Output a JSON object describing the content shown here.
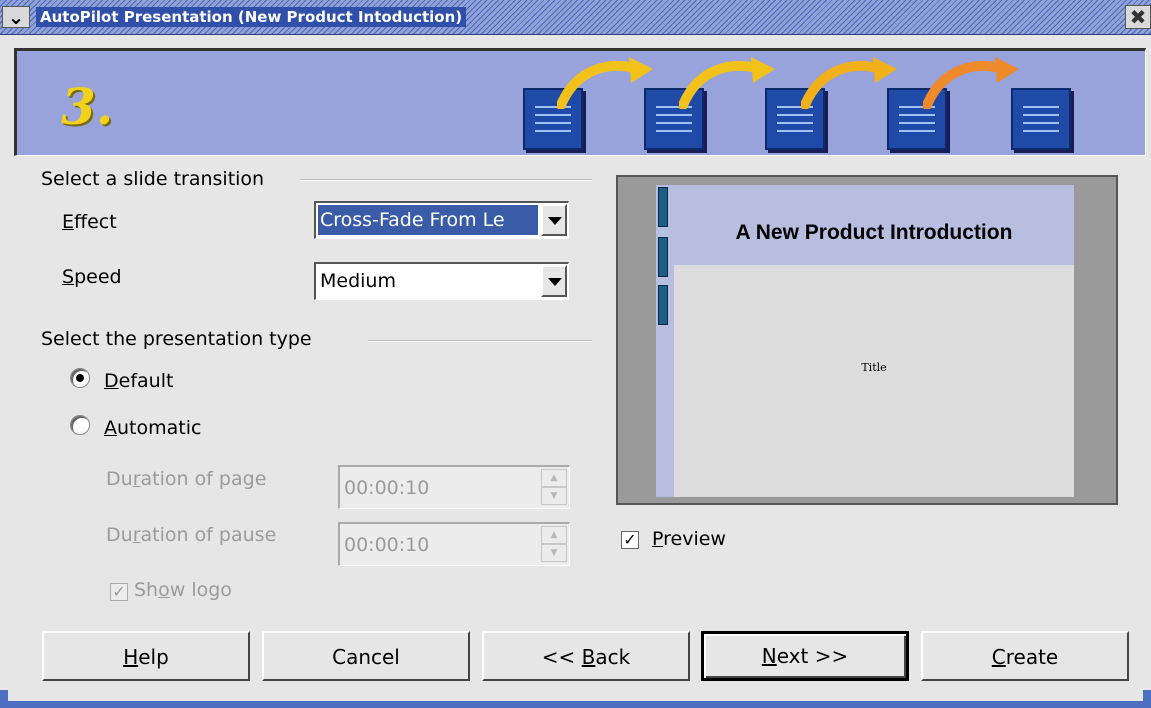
{
  "window": {
    "title": "AutoPilot Presentation (New Product Intoduction)",
    "close_glyph": "✖",
    "menu_glyph": "⌄"
  },
  "banner": {
    "step": "3.",
    "colors": {
      "background": "#98a2db",
      "step": "#f2d21a",
      "slide_icon": "#1f4aa8",
      "arrow": "#f2c21a"
    }
  },
  "transition": {
    "group_label": "Select a slide transition",
    "effect": {
      "label_prefix": "",
      "label_mnemonic": "E",
      "label_rest": "ffect",
      "value": "Cross-Fade From Le"
    },
    "speed": {
      "label_mnemonic": "S",
      "label_rest": "peed",
      "value": "Medium"
    }
  },
  "presentation_type": {
    "group_label": "Select the presentation type",
    "default": {
      "mnemonic": "D",
      "rest": "efault",
      "selected": true
    },
    "automatic": {
      "mnemonic": "A",
      "rest": "utomatic",
      "selected": false
    },
    "duration_page": {
      "label_a": "Du",
      "label_mnemonic": "r",
      "label_b": "ation of page",
      "value": "00:00:10"
    },
    "duration_pause": {
      "label_a": "Du",
      "label_mnemonic": "r",
      "label_b": "ation of pause",
      "value": "00:00:10"
    },
    "show_logo": {
      "label_a": "Sh",
      "label_mnemonic": "o",
      "label_b": "w logo",
      "checked": true,
      "check_glyph": "✓"
    }
  },
  "preview": {
    "slide_title": "A New Product Introduction",
    "slide_subtitle": "Title",
    "checkbox": {
      "mnemonic": "P",
      "rest": "review",
      "checked": true,
      "check_glyph": "✓"
    }
  },
  "buttons": {
    "help": {
      "mnemonic": "H",
      "rest": "elp"
    },
    "cancel": {
      "label": "Cancel"
    },
    "back": {
      "prefix": "<< ",
      "mnemonic": "B",
      "rest": "ack"
    },
    "next": {
      "mnemonic": "N",
      "rest": "ext >>"
    },
    "create": {
      "mnemonic": "C",
      "rest": "reate"
    }
  }
}
